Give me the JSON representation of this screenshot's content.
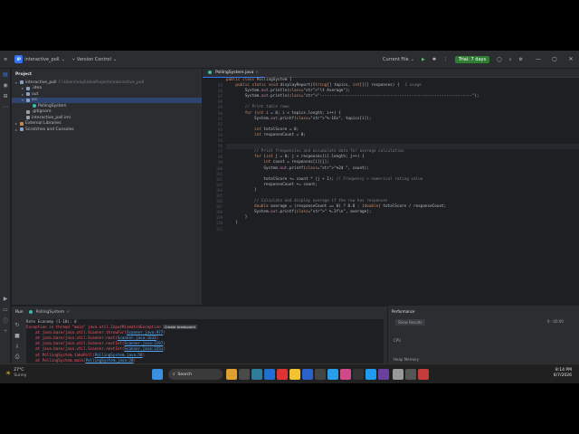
{
  "titlebar": {
    "project_badge": "IP",
    "project": "interactive_poll",
    "vcs": "Version Control",
    "current_file": "Current File",
    "trial": "Trial: 7 days"
  },
  "project_panel": {
    "title": "Project",
    "tree": [
      {
        "label": "interactive_poll",
        "path": "C:\\Users\\olaji\\IdeaProjects\\interactive_poll",
        "indent": 0,
        "arrow": "▾",
        "icon": "fold"
      },
      {
        "label": ".idea",
        "indent": 1,
        "arrow": "▸",
        "icon": "fold"
      },
      {
        "label": "out",
        "indent": 1,
        "arrow": "▸",
        "icon": "fold"
      },
      {
        "label": "src",
        "indent": 1,
        "arrow": "▾",
        "icon": "fold",
        "selected": true
      },
      {
        "label": "PollingSystem",
        "indent": 2,
        "arrow": "",
        "icon": "java"
      },
      {
        "label": ".gitignore",
        "indent": 1,
        "arrow": "",
        "icon": "txt"
      },
      {
        "label": "interactive_poll.iml",
        "indent": 1,
        "arrow": "",
        "icon": "txt"
      },
      {
        "label": "External Libraries",
        "indent": 0,
        "arrow": "▸",
        "icon": "lib"
      },
      {
        "label": "Scratches and Consoles",
        "indent": 0,
        "arrow": "▸",
        "icon": "fold"
      }
    ]
  },
  "editor": {
    "tab": "PollingSystem.java",
    "usage": "1 usage",
    "lines": [
      {
        "n": "",
        "t": "public class PollingSystem {"
      },
      {
        "n": "85",
        "t": "    public static void displayReport(String[] topics, int[][] responses) {"
      },
      {
        "n": "86",
        "t": "        System.out.println(\"\\t Average\");"
      },
      {
        "n": "87",
        "t": "        System.out.println(\"-----------------------------------------------------------------\");"
      },
      {
        "n": "88",
        "t": ""
      },
      {
        "n": "89",
        "t": "        // Print table rows"
      },
      {
        "n": "90",
        "t": "        for (int i = 0; i < topics.length; i++) {"
      },
      {
        "n": "91",
        "t": "            System.out.printf(\"%-16s\", topics[i]);"
      },
      {
        "n": "92",
        "t": ""
      },
      {
        "n": "93",
        "t": "            int totalScore = 0;"
      },
      {
        "n": "94",
        "t": "            int responseCount = 0;"
      },
      {
        "n": "95",
        "t": ""
      },
      {
        "n": "96",
        "t": ""
      },
      {
        "n": "97",
        "t": "            // Print frequencies and accumulate data for average calculation"
      },
      {
        "n": "98",
        "t": "            for (int j = 0; j < responses[i].length; j++) {"
      },
      {
        "n": "99",
        "t": "                int count = responses[i][j];"
      },
      {
        "n": "100",
        "t": "                System.out.printf(\"%2d \", count);"
      },
      {
        "n": "101",
        "t": ""
      },
      {
        "n": "102",
        "t": "                totalScore += count * (j + 1); // Frequency × numerical rating value"
      },
      {
        "n": "103",
        "t": "                responseCount += count;"
      },
      {
        "n": "104",
        "t": "            }"
      },
      {
        "n": "105",
        "t": ""
      },
      {
        "n": "106",
        "t": "            // Calculate and display average if the row has responses"
      },
      {
        "n": "107",
        "t": "            double average = (responseCount == 0) ? 0.0 : (double) totalScore / responseCount;"
      },
      {
        "n": "108",
        "t": "            System.out.printf(\" %.2f\\n\", average);"
      },
      {
        "n": "109",
        "t": "        }"
      },
      {
        "n": "110",
        "t": "    }"
      },
      {
        "n": "111",
        "t": ""
      }
    ]
  },
  "run": {
    "label": "Run",
    "tab": "PollingSystem",
    "tooltip": "Create breakpoint",
    "console": [
      {
        "k": "plain",
        "t": "Rate Economy (1-10): d"
      },
      {
        "k": "err",
        "t": "Exception in thread \"main\" java.util.InputMismatchException"
      },
      {
        "k": "err",
        "t": "    at java.base/java.util.Scanner.throwFor(Scanner.java:977)"
      },
      {
        "k": "err",
        "t": "    at java.base/java.util.Scanner.next(Scanner.java:1633)"
      },
      {
        "k": "err",
        "t": "    at java.base/java.util.Scanner.nextInt(Scanner.java:2297)"
      },
      {
        "k": "err",
        "t": "    at java.base/java.util.Scanner.nextInt(Scanner.java:2251)"
      },
      {
        "k": "err",
        "t": "    at PollingSystem.takePoll(PollingSystem.java:58)"
      },
      {
        "k": "err",
        "t": "    at PollingSystem.main(PollingSystem.java:20)"
      },
      {
        "k": "plain",
        "t": ""
      },
      {
        "k": "plain",
        "t": "Process finished with exit code 1"
      }
    ]
  },
  "performance": {
    "title": "Performance",
    "show_results": "Show Results",
    "cpu": "CPU",
    "heap": "Heap Memory",
    "mem": "0 : 00:00"
  },
  "statusbar": {
    "crumbs": [
      "interactive_poll",
      "src",
      "PollingSystem",
      "displayReport"
    ],
    "position": "100:52 (153 chars, 1 line break)",
    "line_sep": "LF",
    "encoding": "UTF-8",
    "indent": "4 spaces"
  },
  "taskbar": {
    "temp": "27°C",
    "weather": "Sunny",
    "search": "Search",
    "time": "8:14 PM",
    "date": "6/7/2026"
  },
  "colors": {
    "accent": "#3574f0",
    "error": "#f75464",
    "string": "#6aab73",
    "keyword": "#cf8e6d"
  }
}
